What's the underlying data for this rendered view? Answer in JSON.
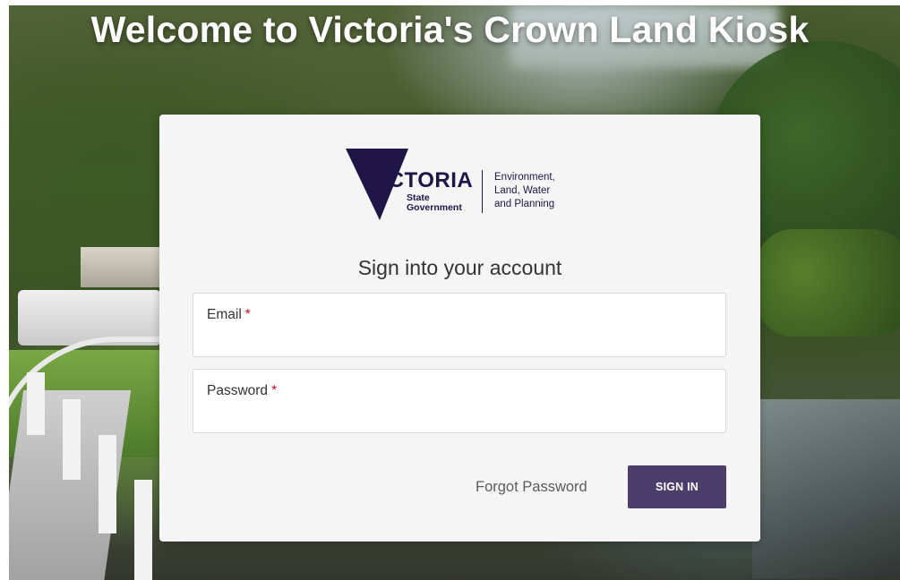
{
  "page": {
    "headline": "Welcome to Victoria's Crown Land Kiosk"
  },
  "logo": {
    "word": "VICTORIA",
    "sub_line1": "State",
    "sub_line2": "Government",
    "dept_line1": "Environment,",
    "dept_line2": "Land, Water",
    "dept_line3": "and Planning",
    "brand_color": "#201547"
  },
  "form": {
    "title": "Sign into your account",
    "email": {
      "label": "Email",
      "required_mark": "*",
      "value": ""
    },
    "password": {
      "label": "Password",
      "required_mark": "*",
      "value": ""
    },
    "forgot_label": "Forgot Password",
    "signin_label": "SIGN IN",
    "signin_color": "#4b3e6b",
    "required_color": "#c8102e"
  }
}
